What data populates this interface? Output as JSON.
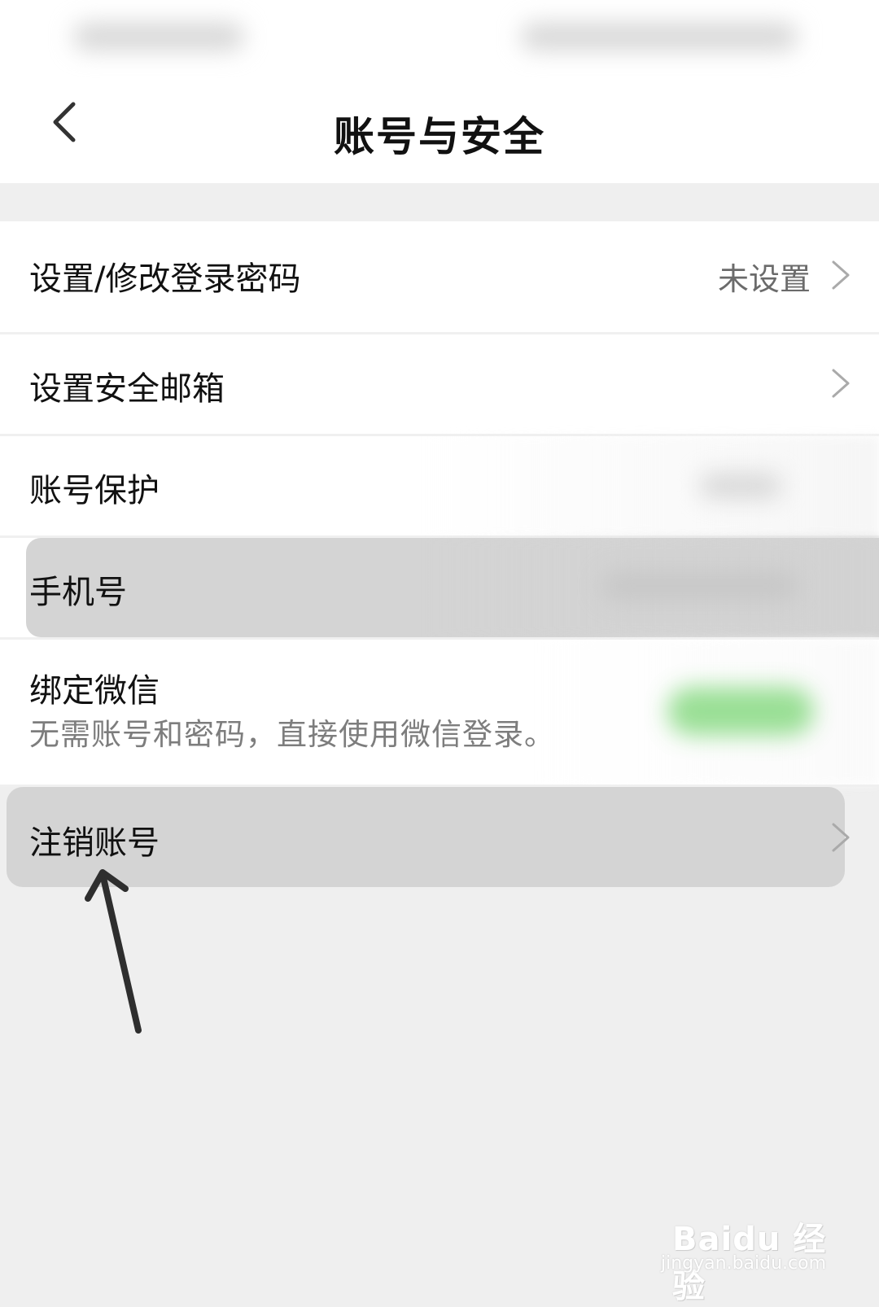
{
  "header": {
    "title": "账号与安全"
  },
  "rows": [
    {
      "label": "设置/修改登录密码",
      "value": "未设置"
    },
    {
      "label": "设置安全邮箱"
    },
    {
      "label": "账号保护"
    },
    {
      "label": "手机号"
    },
    {
      "label": "绑定微信",
      "sub": "无需账号和密码，直接使用微信登录。"
    },
    {
      "label": "注销账号"
    }
  ],
  "watermark": {
    "brand": "Baidu 经验",
    "url": "jingyan.baidu.com"
  },
  "icons": {
    "back": "back-chevron-icon",
    "chevron": "chevron-right-icon",
    "arrow": "annotation-arrow-icon"
  },
  "colors": {
    "toggle": "#8fdc8a",
    "highlight": "#d4d4d4",
    "background": "#efefef"
  }
}
